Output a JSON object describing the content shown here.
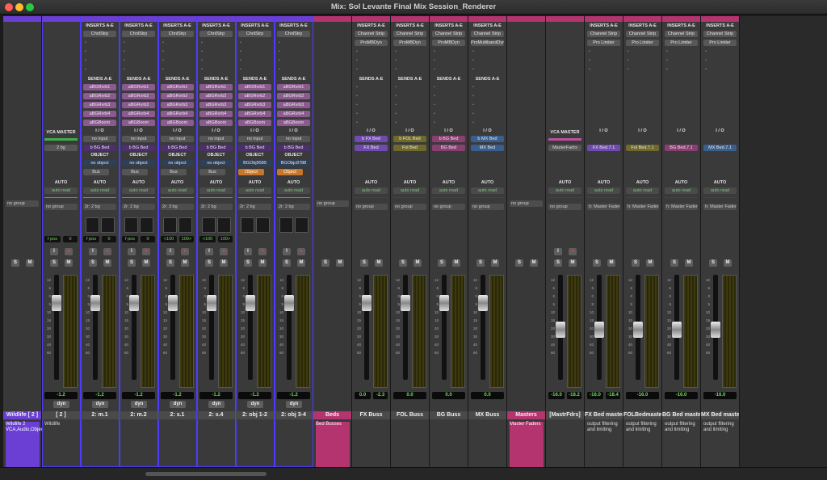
{
  "window": {
    "title": "Mix: Sol Levante Final Mix Session_Renderer",
    "traffic_lights": [
      "#ff5f57",
      "#febc2e",
      "#28c840"
    ]
  },
  "colors": {
    "purple_folder": "#6b3fd4",
    "pink_folder": "#b4346f",
    "vca_purple": "#5c3aa8",
    "bed_fx": "#6f4bb0",
    "bed_fol": "#6f6a2c",
    "bed_bg": "#8a3f73",
    "bed_mx": "#3a5e8e",
    "meter_green": "#6fdc5a"
  },
  "labels": {
    "inserts": "INSERTS A-E",
    "sends": "SENDS A-E",
    "io": "I / O",
    "object": "OBJECT",
    "auto": "AUTO",
    "auto_read": "auto read",
    "no_group": "no group",
    "vca_master": "VCA MASTER",
    "no_input": "no input",
    "no_object": "no object",
    "bus": "Bus",
    "object_btn": "Object",
    "solo": "S",
    "mute": "M",
    "dyn": "dyn",
    "input_btn": "I",
    "output_fil": "output filtering and limiting"
  },
  "scale": [
    "12",
    "6",
    "0",
    "5",
    "10",
    "15",
    "20",
    "30",
    "40",
    "60"
  ],
  "strips": [
    {
      "name": "Wildlife [ 2 ]",
      "color": "purple",
      "type": "folder",
      "comment": "Wildlife 2 VCA,Audio,Objects",
      "volume": "",
      "group": "no group"
    },
    {
      "name": "[ 2 ]",
      "color": "purple",
      "type": "vca",
      "comment": "Wildlife",
      "volume": "-1.2",
      "group": "no group",
      "vca_out": "2 bg",
      "pan_label": [
        "f pos",
        "0"
      ]
    },
    {
      "name": "2: m.1",
      "color": "purple",
      "type": "audio",
      "inserts": [
        "ChnlStrp"
      ],
      "sends": [
        "aBGRvrb1",
        "aBGRvrb2",
        "aBGRvrb3",
        "aBGRvrb4",
        "aBGBoom"
      ],
      "io_out": "b BG Bed",
      "object": "no object",
      "volume": "-1.2",
      "group": "2r: 2 bg",
      "pan_label": [
        "f pos",
        "0"
      ],
      "comment": ""
    },
    {
      "name": "2: m.2",
      "color": "purple",
      "type": "audio",
      "inserts": [
        "ChnlStrp"
      ],
      "sends": [
        "aBGRvrb1",
        "aBGRvrb2",
        "aBGRvrb3",
        "aBGRvrb4",
        "aBGBoom"
      ],
      "io_out": "b BG Bed",
      "object": "no object",
      "volume": "-1.2",
      "group": "2r: 2 bg",
      "pan_label": [
        "f pos",
        "0"
      ],
      "comment": ""
    },
    {
      "name": "2: s.1",
      "color": "purple",
      "type": "audio",
      "inserts": [
        "ChnlStrp"
      ],
      "sends": [
        "aBGRvrb1",
        "aBGRvrb2",
        "aBGRvrb3",
        "aBGRvrb4",
        "aBGBoom"
      ],
      "io_out": "b BG Bed",
      "object": "no object",
      "volume": "-1.2",
      "group": "2r: 3 bg",
      "pan_label": [
        "<100",
        "100>"
      ],
      "comment": ""
    },
    {
      "name": "2: s.4",
      "color": "purple",
      "type": "audio",
      "inserts": [
        "ChnlStrp"
      ],
      "sends": [
        "aBGRvrb1",
        "aBGRvrb2",
        "aBGRvrb3",
        "aBGRvrb4",
        "aBGBoom"
      ],
      "io_out": "b BG Bed",
      "object": "no object",
      "volume": "-1.2",
      "group": "2r: 2 bg",
      "pan_label": [
        "<100",
        "100>"
      ],
      "comment": ""
    },
    {
      "name": "2: obj 1-2",
      "color": "purple",
      "type": "audio",
      "inserts": [
        "ChnlStrp"
      ],
      "sends": [
        "aBGRvrb1",
        "aBGRvrb2",
        "aBGRvrb3",
        "aBGRvrb4",
        "aBGBoom"
      ],
      "io_out": "b BG Bed",
      "object": "BGObj9589",
      "volume": "-1.2",
      "group": "2r: 2 bg",
      "pan_label": [
        "",
        ""
      ],
      "comment": ""
    },
    {
      "name": "2: obj 3-4",
      "color": "purple",
      "type": "audio",
      "inserts": [
        "ChnlStrp"
      ],
      "sends": [
        "aBGRvrb1",
        "aBGRvrb2",
        "aBGRvrb3",
        "aBGRvrb4",
        "aBGBoom"
      ],
      "io_out": "b BG Bed",
      "object": "BGObjc8788",
      "volume": "-1.2",
      "group": "2r: 2 bg",
      "pan_label": [
        "",
        ""
      ],
      "comment": ""
    },
    {
      "name": "Beds",
      "color": "pink",
      "type": "folder",
      "comment": "Bed Busses",
      "volume": "",
      "group": "no group"
    },
    {
      "name": "FX Buss",
      "color": "pink",
      "type": "bus",
      "inserts": [
        "Channel Strip",
        "ProMBDyn"
      ],
      "io_in": "b FX Bed",
      "io_out": "FX Bed",
      "bedcolor": "fx",
      "volume": "0.0",
      "volume2": "-2.3",
      "group": "no group",
      "comment": ""
    },
    {
      "name": "FOL Buss",
      "color": "pink",
      "type": "bus",
      "inserts": [
        "Channel Strip",
        "ProMBDyn"
      ],
      "io_in": "b FOL Bed",
      "io_out": "Fol Bed",
      "bedcolor": "fol",
      "volume": "0.0",
      "volume2": "",
      "group": "no group",
      "comment": ""
    },
    {
      "name": "BG Buss",
      "color": "pink",
      "type": "bus",
      "inserts": [
        "Channel Strip",
        "ProMBDyn"
      ],
      "io_in": "b BG Bed",
      "io_out": "BG Bed",
      "bedcolor": "bg",
      "volume": "0.0",
      "volume2": "",
      "group": "no group",
      "comment": ""
    },
    {
      "name": "MX Buss",
      "color": "pink",
      "type": "bus",
      "inserts": [
        "Channel Strip",
        "ProMultibandDyn"
      ],
      "io_in": "b MX Bed",
      "io_out": "MX Bed",
      "bedcolor": "mx",
      "volume": "0.0",
      "volume2": "",
      "group": "no group",
      "comment": ""
    },
    {
      "name": "Masters",
      "color": "pink",
      "type": "folder",
      "comment": "Master Faders",
      "volume": "",
      "group": "no group"
    },
    {
      "name": "[MastrFdrs]",
      "color": "pink",
      "type": "vcam",
      "comment": "",
      "volume": "-16.0",
      "volume2": "-18.2",
      "group": "no group",
      "vca_out": "MasterFadrs"
    },
    {
      "name": "FX Bed master",
      "color": "pink",
      "type": "master",
      "inserts": [
        "Channel Strip",
        "Pro Limiter"
      ],
      "io_out": "FX Bed.7.1",
      "bedcolor": "fx",
      "volume": "-16.0",
      "volume2": "-18.4",
      "group": "h: Master Faders",
      "comment": "output filtering and limiting"
    },
    {
      "name": "FOLBedmaster",
      "color": "pink",
      "type": "master",
      "inserts": [
        "Channel Strip",
        "Pro Limiter"
      ],
      "io_out": "Fol Bed.7.1",
      "bedcolor": "fol",
      "volume": "-16.0",
      "volume2": "",
      "group": "h: Master Faders",
      "comment": "output filtering and limiting"
    },
    {
      "name": "BG Bed master",
      "color": "pink",
      "type": "master",
      "inserts": [
        "Channel Strip",
        "Pro Limiter"
      ],
      "io_out": "BG Bed.7.1",
      "bedcolor": "bg",
      "volume": "-16.0",
      "volume2": "",
      "group": "h: Master Faders",
      "comment": "output filtering and limiting"
    },
    {
      "name": "MX Bed master",
      "color": "pink",
      "type": "master",
      "inserts": [
        "Channel Strip",
        "Pro Limiter"
      ],
      "io_out": "MX Bed.7.1",
      "bedcolor": "mx",
      "volume": "-16.0",
      "volume2": "",
      "group": "h: Master Faders",
      "comment": "output filtering and limiting"
    }
  ]
}
